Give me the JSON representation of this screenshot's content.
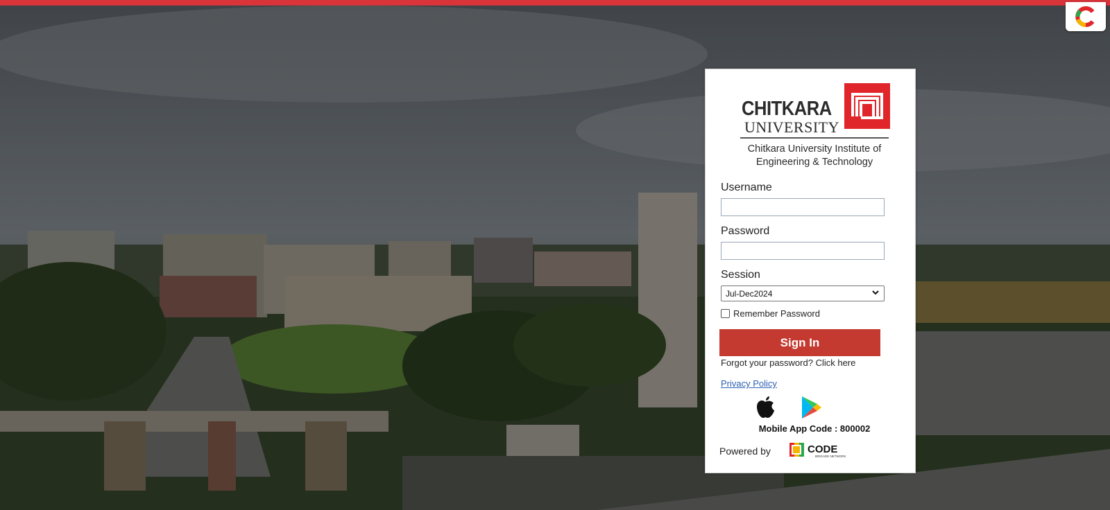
{
  "brand": {
    "name_top": "CHITKARA",
    "name_bottom": "UNIVERSITY",
    "institute": "Chitkara University Institute of Engineering & Technology",
    "accent": "#e0262b"
  },
  "form": {
    "username_label": "Username",
    "username_value": "",
    "password_label": "Password",
    "password_value": "",
    "session_label": "Session",
    "session_selected": "Jul-Dec2024",
    "remember_label": "Remember Password",
    "remember_checked": false,
    "signin_label": "Sign In",
    "forgot_text": "Forgot your password? Click here",
    "privacy_text": "Privacy Policy",
    "button_color": "#c53a30"
  },
  "mobile": {
    "apple_icon": "apple-icon",
    "play_icon": "google-play-icon",
    "app_code_text": "Mobile App Code : 800002"
  },
  "footer": {
    "powered_by": "Powered by",
    "partner_word": "CODE",
    "partner_tagline": "BRIGADE NETWORK"
  },
  "colors": {
    "top_bar": "#d8343a"
  }
}
